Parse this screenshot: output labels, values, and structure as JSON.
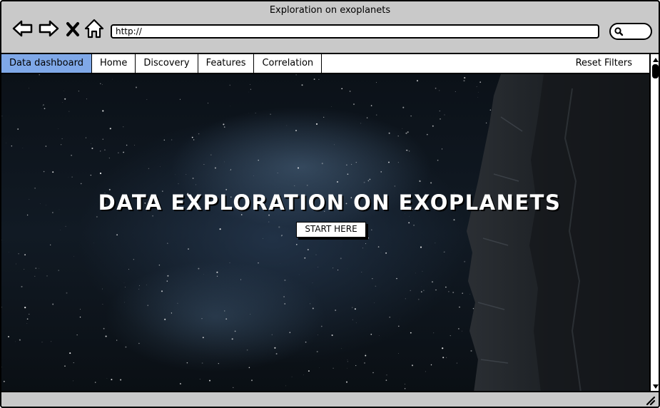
{
  "window": {
    "title": "Exploration on exoplanets"
  },
  "toolbar": {
    "back_icon": "back-arrow-icon",
    "forward_icon": "forward-arrow-icon",
    "stop_icon": "close-icon",
    "home_icon": "home-icon",
    "url": "http://",
    "search_icon": "search-icon"
  },
  "menu": {
    "tabs": [
      {
        "label": "Data dashboard",
        "active": true
      },
      {
        "label": "Home",
        "active": false
      },
      {
        "label": "Discovery",
        "active": false
      },
      {
        "label": "Features",
        "active": false
      },
      {
        "label": "Correlation",
        "active": false
      }
    ],
    "reset_label": "Reset Filters"
  },
  "hero": {
    "title": "DATA EXPLORATION ON EXOPLANETS",
    "button_label": "START HERE"
  },
  "colors": {
    "active_tab": "#7fa8e8",
    "chrome": "#c9c9c9"
  }
}
